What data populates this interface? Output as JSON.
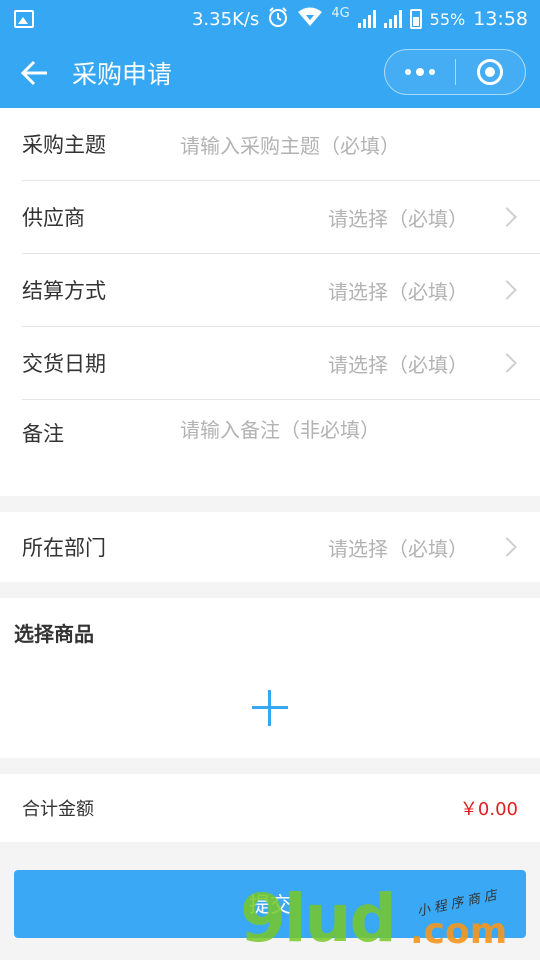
{
  "status_bar": {
    "net_speed": "3.35K/s",
    "network_type": "4G",
    "battery": "55%",
    "time": "13:58",
    "icons": [
      "image-icon",
      "alarm-icon",
      "wifi-icon",
      "signal-icon",
      "signal-icon",
      "battery-icon"
    ]
  },
  "navbar": {
    "title": "采购申请",
    "icons": [
      "back-arrow-icon",
      "more-dots-icon",
      "close-target-icon"
    ],
    "color": "#36a7f3"
  },
  "form": {
    "subject": {
      "label": "采购主题",
      "placeholder": "请输入采购主题（必填）"
    },
    "supplier": {
      "label": "供应商",
      "placeholder": "请选择（必填）"
    },
    "settlement": {
      "label": "结算方式",
      "placeholder": "请选择（必填）"
    },
    "delivery_date": {
      "label": "交货日期",
      "placeholder": "请选择（必填）"
    },
    "remark": {
      "label": "备注",
      "placeholder": "请输入备注（非必填）"
    },
    "department": {
      "label": "所在部门",
      "placeholder": "请选择（必填）"
    }
  },
  "goods": {
    "title": "选择商品",
    "add_icon": "plus-icon"
  },
  "total": {
    "label": "合计金额",
    "value": "￥0.00",
    "value_color": "#e02020"
  },
  "submit": {
    "label": "提交"
  },
  "watermark": {
    "main": "9lud",
    "domain": ".com",
    "tagline": "小程序商店"
  }
}
